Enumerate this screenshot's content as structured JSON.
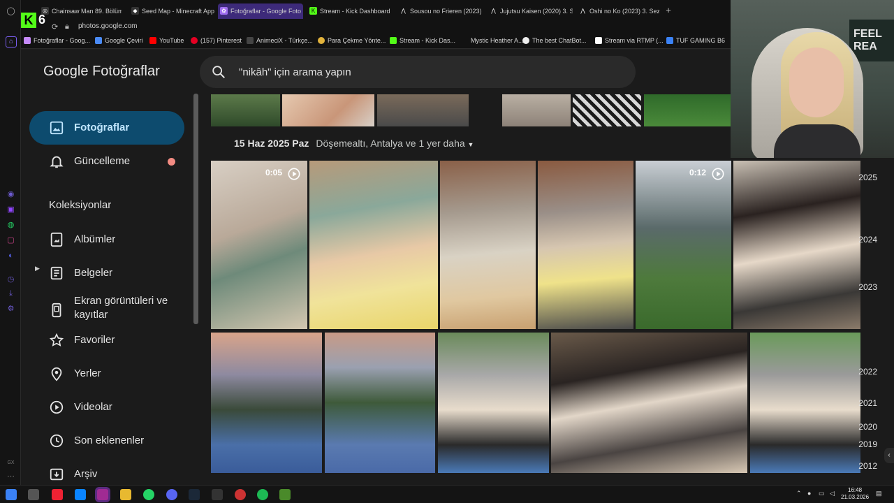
{
  "tabs": [
    {
      "label": "Chainsaw Man 89. Bölüm",
      "color": "#ffffff"
    },
    {
      "label": "Seed Map - Minecraft App",
      "color": "#ffffff"
    },
    {
      "label": "Fotoğraflar - Google Foto",
      "color": "#c58af9"
    },
    {
      "label": "Stream - Kick Dashboard",
      "color": "#53fc18"
    },
    {
      "label": "Sousou no Frieren (2023)",
      "color": "#ffffff"
    },
    {
      "label": "Jujutsu Kaisen (2020) 3. S",
      "color": "#ffffff"
    },
    {
      "label": "Oshi no Ko (2023) 3. Sezo",
      "color": "#ffffff"
    }
  ],
  "address": {
    "url": "photos.google.com",
    "kick_count": "6"
  },
  "bookmarks": [
    "Fotoğraflar - Goog...",
    "Google Çeviri",
    "YouTube",
    "(157) Pinterest",
    "AnimeciX - Türkçe...",
    "Para Çekme Yönte...",
    "Stream - Kick Das...",
    "Mystic Heather A...",
    "The best ChatBot...",
    "Stream via RTMP (...",
    "TUF GAMING B6"
  ],
  "app": {
    "logo_google": "Google",
    "logo_product": "Fotoğraflar",
    "search_placeholder": "\"nikâh\" için arama yapın"
  },
  "sidebar": {
    "photos": "Fotoğraflar",
    "updates": "Güncelleme",
    "collections_header": "Koleksiyonlar",
    "albums": "Albümler",
    "documents": "Belgeler",
    "screenshots_line1": "Ekran görüntüleri ve",
    "screenshots_line2": "kayıtlar",
    "favorites": "Favoriler",
    "places": "Yerler",
    "videos": "Videolar",
    "recent": "Son eklenenler",
    "archive": "Arşiv"
  },
  "section": {
    "date": "15 Haz 2025 Paz",
    "location": "Döşemealtı, Antalya ve 1 yer daha"
  },
  "videos": [
    {
      "duration": "0:05"
    },
    {
      "duration": "0:12"
    }
  ],
  "years": [
    "2025",
    "2024",
    "2023",
    "2022",
    "2021",
    "2020",
    "2019",
    "2012"
  ],
  "clock": {
    "time": "16:48",
    "date": "21.03.2026"
  },
  "webcam_text": "FEEL REA"
}
